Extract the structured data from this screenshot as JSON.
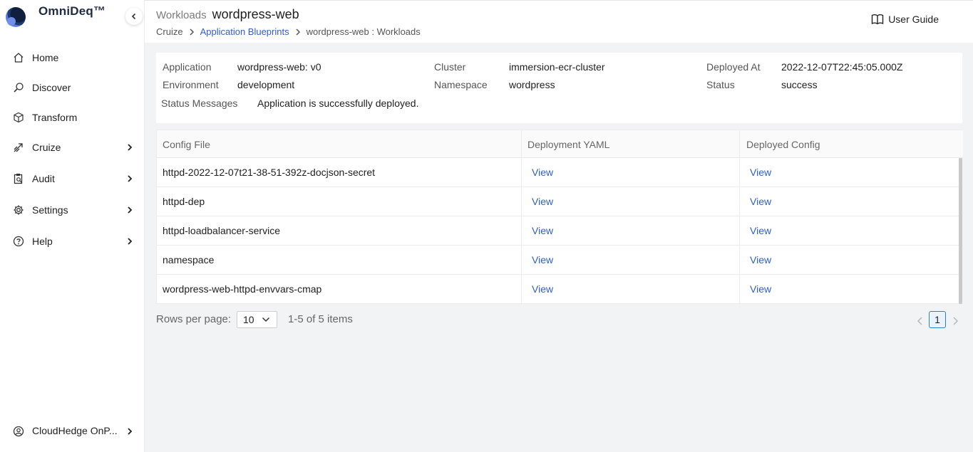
{
  "brand": {
    "name": "OmniDeq™"
  },
  "sidebar": {
    "items": [
      {
        "label": "Home",
        "icon": "home-icon",
        "has_submenu": false
      },
      {
        "label": "Discover",
        "icon": "discover-icon",
        "has_submenu": false
      },
      {
        "label": "Transform",
        "icon": "cube-icon",
        "has_submenu": false
      },
      {
        "label": "Cruize",
        "icon": "cruize-icon",
        "has_submenu": true
      },
      {
        "label": "Audit",
        "icon": "audit-icon",
        "has_submenu": true
      },
      {
        "label": "Settings",
        "icon": "gear-icon",
        "has_submenu": true
      },
      {
        "label": "Help",
        "icon": "help-icon",
        "has_submenu": true
      }
    ],
    "account": {
      "label": "CloudHedge OnP...",
      "icon": "user-icon"
    }
  },
  "header": {
    "title_prefix": "Workloads",
    "title": "wordpress-web",
    "breadcrumb": [
      "Cruize",
      "Application Blueprints",
      "wordpress-web : Workloads"
    ],
    "user_guide_label": "User Guide"
  },
  "info": {
    "application_label": "Application",
    "application_value": "wordpress-web: v0",
    "environment_label": "Environment",
    "environment_value": "development",
    "cluster_label": "Cluster",
    "cluster_value": "immersion-ecr-cluster",
    "namespace_label": "Namespace",
    "namespace_value": "wordpress",
    "deployed_at_label": "Deployed At",
    "deployed_at_value": "2022-12-07T22:45:05.000Z",
    "status_label": "Status",
    "status_value": "success",
    "status_messages_label": "Status Messages",
    "status_messages_value": "Application is successfully deployed."
  },
  "table": {
    "columns": [
      "Config File",
      "Deployment YAML",
      "Deployed Config"
    ],
    "rows": [
      {
        "file": "httpd-2022-12-07t21-38-51-392z-docjson-secret",
        "yaml": "View",
        "config": "View"
      },
      {
        "file": "httpd-dep",
        "yaml": "View",
        "config": "View"
      },
      {
        "file": "httpd-loadbalancer-service",
        "yaml": "View",
        "config": "View"
      },
      {
        "file": "namespace",
        "yaml": "View",
        "config": "View"
      },
      {
        "file": "wordpress-web-httpd-envvars-cmap",
        "yaml": "View",
        "config": "View"
      }
    ]
  },
  "pagination": {
    "rows_per_page_label": "Rows per page:",
    "rows_per_page_value": "10",
    "items_text": "1-5 of 5 items",
    "current_page": "1"
  },
  "colors": {
    "link": "#2f5fbf",
    "active_page_border": "#2f7fc7"
  }
}
